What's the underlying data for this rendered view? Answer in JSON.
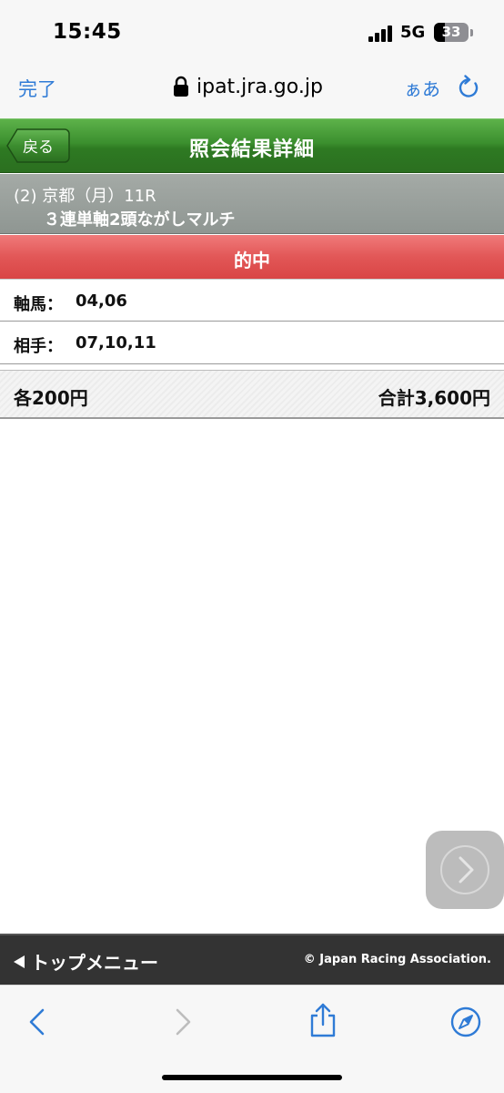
{
  "status_bar": {
    "time": "15:45",
    "network": "5G",
    "battery": "33"
  },
  "browser": {
    "done_label": "完了",
    "url": "ipat.jra.go.jp",
    "text_size_label": "ぁあ"
  },
  "header": {
    "back_label": "戻る",
    "title": "照会結果詳細"
  },
  "race": {
    "line1": "(2) 京都（月）11R",
    "line2": "３連単軸2頭ながしマルチ"
  },
  "result": {
    "label": "的中"
  },
  "bet": {
    "axis_label": "軸馬：",
    "axis_value": "04,06",
    "partner_label": "相手：",
    "partner_value": "07,10,11",
    "unit_price": "各200円",
    "total": "合計3,600円"
  },
  "footer": {
    "top_menu_label": "トップメニュー",
    "copyright": "© Japan Racing Association."
  },
  "colors": {
    "header_green": "#3b8f2e",
    "race_gray": "#979e9a",
    "result_red": "#e25757",
    "footer_dark": "#333333",
    "ios_blue": "#2f7bd6"
  },
  "icons": {
    "lock": "lock-icon",
    "reload": "reload-icon",
    "back": "back-chevron-icon",
    "forward": "forward-chevron-icon",
    "share": "share-icon",
    "compass": "compass-icon",
    "next": "chevron-right-icon"
  }
}
